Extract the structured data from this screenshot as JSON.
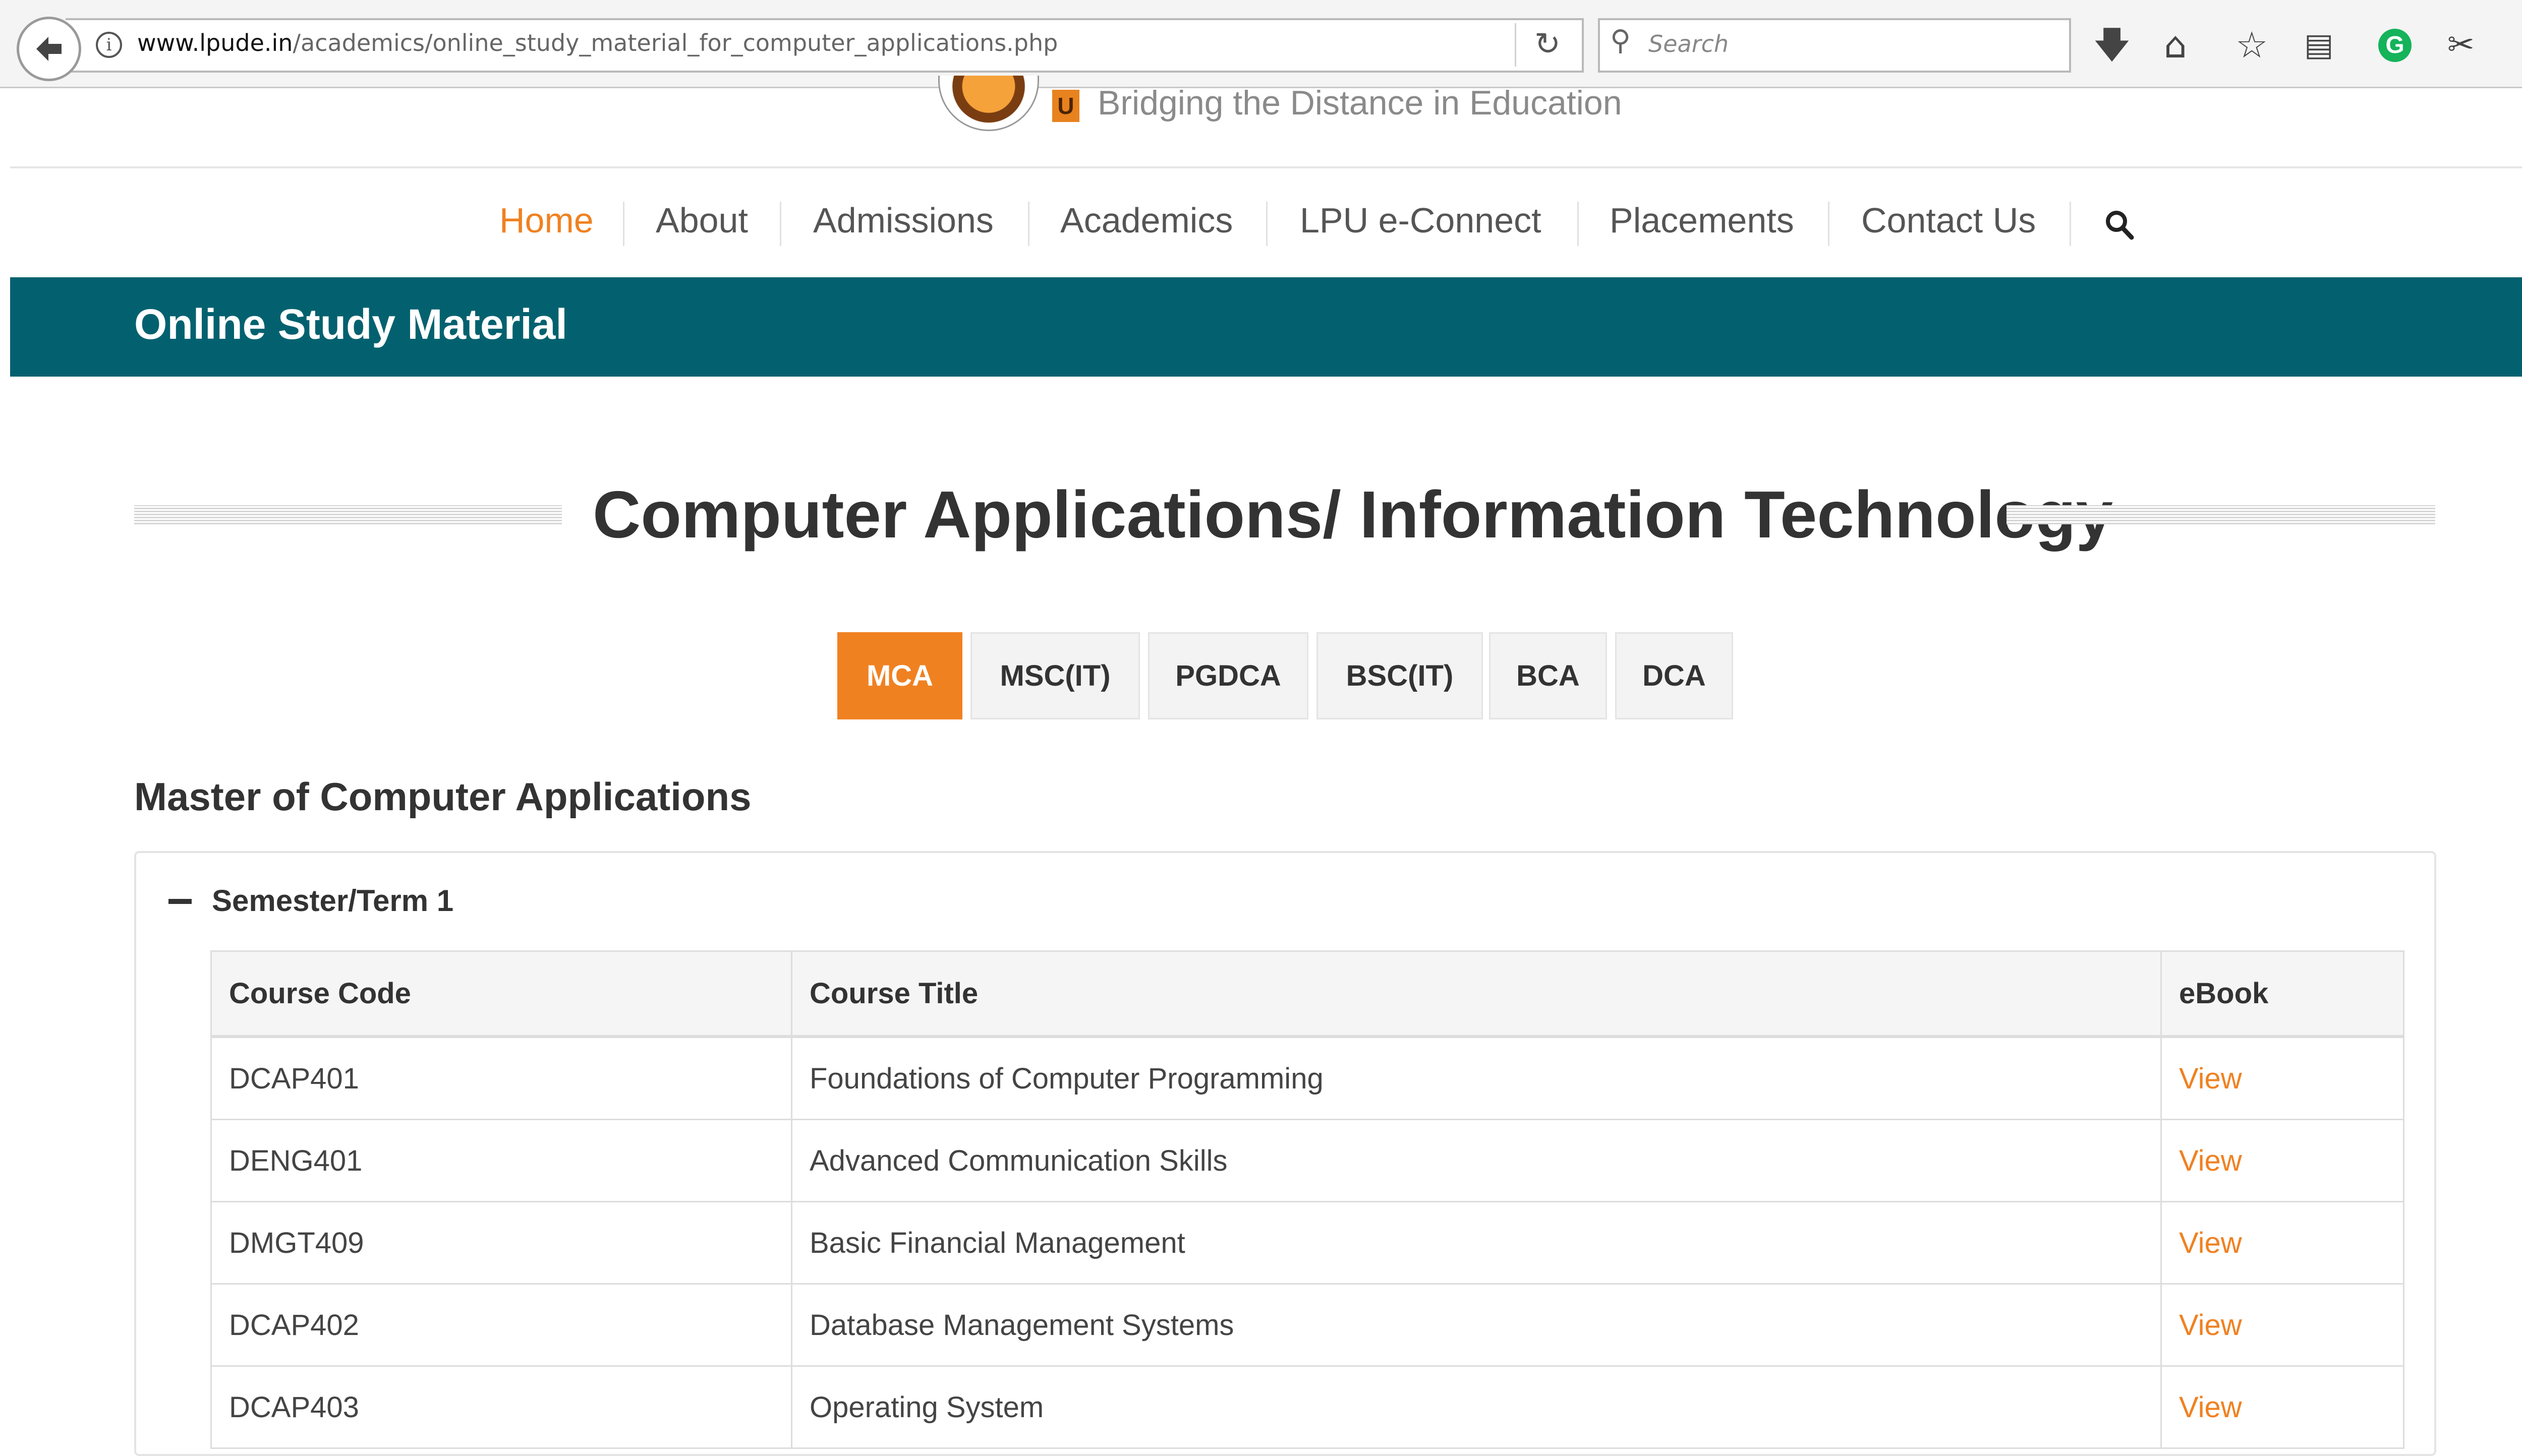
{
  "browser": {
    "url_domain": "www.lpude.in",
    "url_path": "/academics/online_study_material_for_computer_applications.php",
    "search_placeholder": "Search",
    "extension_badge": "G"
  },
  "site": {
    "logo_letter": "U",
    "tagline": "Bridging the Distance in Education"
  },
  "nav": {
    "items": [
      "Home",
      "About",
      "Admissions",
      "Academics",
      "LPU e-Connect",
      "Placements",
      "Contact Us"
    ],
    "active": "Home"
  },
  "banner": {
    "title": "Online Study Material"
  },
  "page": {
    "heading": "Computer Applications/ Information Technology",
    "tabs": [
      "MCA",
      "MSC(IT)",
      "PGDCA",
      "BSC(IT)",
      "BCA",
      "DCA"
    ],
    "active_tab": "MCA",
    "program_title": "Master of Computer Applications"
  },
  "semester": {
    "title": "Semester/Term 1",
    "columns": [
      "Course Code",
      "Course Title",
      "eBook"
    ],
    "rows": [
      {
        "code": "DCAP401",
        "title": "Foundations of Computer Programming",
        "ebook": "View"
      },
      {
        "code": "DENG401",
        "title": "Advanced Communication Skills",
        "ebook": "View"
      },
      {
        "code": "DMGT409",
        "title": "Basic Financial Management",
        "ebook": "View"
      },
      {
        "code": "DCAP402",
        "title": "Database Management Systems",
        "ebook": "View"
      },
      {
        "code": "DCAP403",
        "title": "Operating System",
        "ebook": "View"
      }
    ]
  },
  "colors": {
    "accent": "#f08121",
    "banner": "#03616f",
    "text": "#333333"
  },
  "icons": {
    "back": "back-arrow-icon",
    "info": "info-icon",
    "reload": "reload-icon",
    "search": "search-icon",
    "download": "download-icon",
    "home": "home-icon",
    "bookmark": "star-icon",
    "reader": "reader-icon",
    "grammarly": "grammarly-icon",
    "screenshot": "scissors-icon",
    "menu": "hamburger-menu-icon",
    "collapse": "minus-icon"
  }
}
